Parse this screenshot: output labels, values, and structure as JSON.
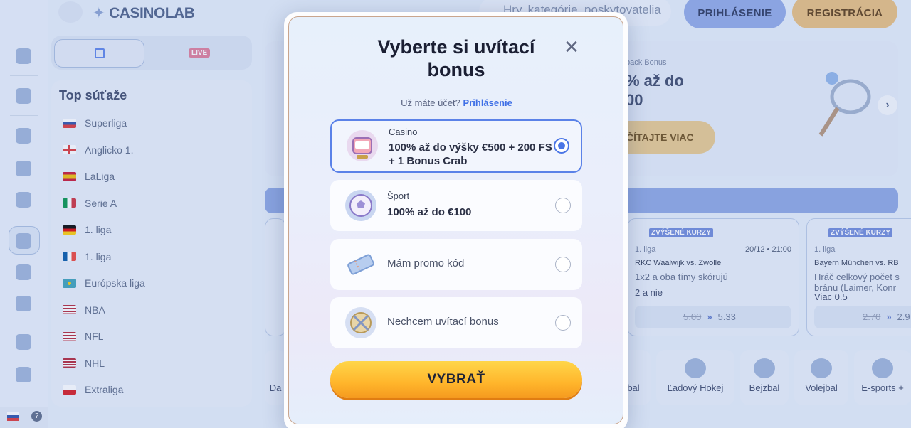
{
  "header": {
    "logo_text": "CASINO",
    "logo_suffix": "LAB",
    "search_placeholder": "Hry, kategórie, poskytovatelia",
    "login_label": "PRIHLÁSENIE",
    "register_label": "REGISTRÁCIA"
  },
  "sidebar": {
    "live_badge": "LIVE",
    "top_title": "Top súťaže",
    "leagues": [
      {
        "name": "Superliga",
        "flag": "sk"
      },
      {
        "name": "Anglicko 1.",
        "flag": "en"
      },
      {
        "name": "LaLiga",
        "flag": "es"
      },
      {
        "name": "Serie A",
        "flag": "it"
      },
      {
        "name": "1. liga",
        "flag": "de"
      },
      {
        "name": "1. liga",
        "flag": "fr"
      },
      {
        "name": "Európska liga",
        "flag": "eu"
      },
      {
        "name": "NBA",
        "flag": "us"
      },
      {
        "name": "NFL",
        "flag": "us"
      },
      {
        "name": "NHL",
        "flag": "us"
      },
      {
        "name": "Extraliga",
        "flag": "cz"
      }
    ]
  },
  "banner": {
    "subtitle": "back Bonus",
    "title_line1": "% až do",
    "title_line2": "00",
    "cta": "ČÍTAJTE VIAC"
  },
  "cards": [
    {
      "tag": "ZVÝŠENÉ KURZY",
      "league": "1. liga",
      "date": "20/12 • 21:00",
      "teams": "RKC Waalwijk vs. Zwolle",
      "bet": "1x2 a oba tímy skórujú",
      "pick": "2 a nie",
      "old_odds": "5.00",
      "new_odds": "5.33"
    },
    {
      "tag": "ZVÝŠENÉ KURZY",
      "league": "1. liga",
      "date": "",
      "teams": "Bayern München vs. RB",
      "bet": "Hráč celkový počet s bránu (Laimer, Konr",
      "pick": "Viac 0.5",
      "old_odds": "2.70",
      "new_odds": "2.9"
    }
  ],
  "sports": [
    "Da",
    "bal",
    "Ľadový Hokej",
    "Bejzbal",
    "Volejbal",
    "E-sports +"
  ],
  "modal": {
    "title": "Vyberte si uvítací bonus",
    "account_text": "Už máte účet?",
    "account_link": "Prihlásenie",
    "options": [
      {
        "category": "Casino",
        "description": "100% až do výšky €500 + 200 FS + 1 Bonus Crab",
        "selected": true
      },
      {
        "category": "Šport",
        "description": "100% až do €100",
        "selected": false
      },
      {
        "category": "",
        "description": "Mám promo kód",
        "selected": false
      },
      {
        "category": "",
        "description": "Nechcem uvítací bonus",
        "selected": false
      }
    ],
    "cta": "VYBRAŤ"
  },
  "colors": {
    "accent": "#4b76e6",
    "cta_yellow": "#ffc23a"
  }
}
